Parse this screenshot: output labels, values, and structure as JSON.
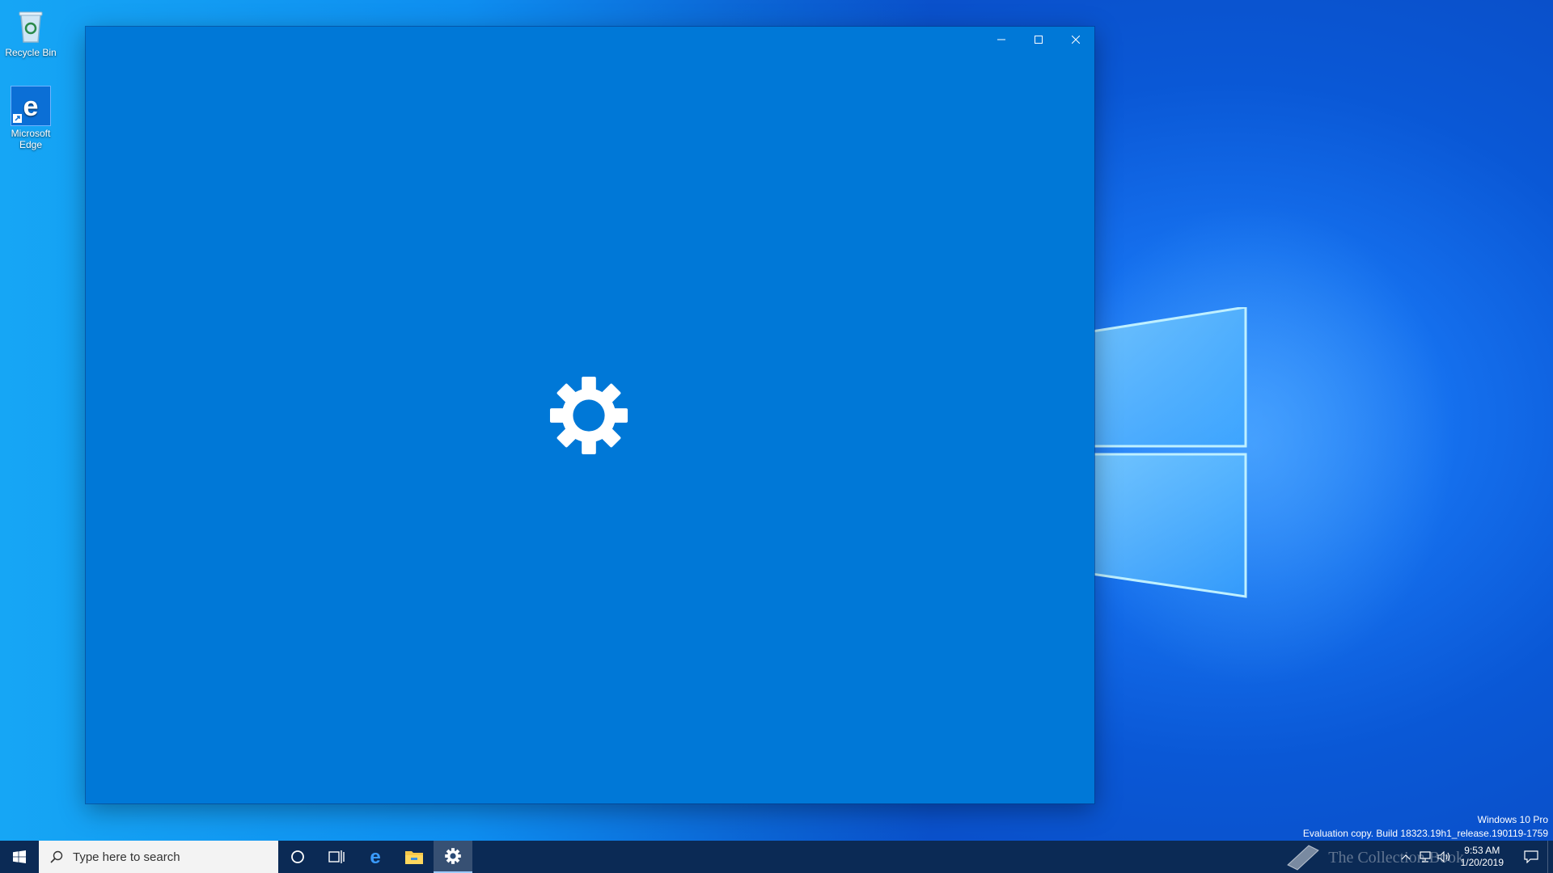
{
  "desktop": {
    "icons": [
      {
        "label": "Recycle Bin",
        "icon": "recycle-bin-icon"
      },
      {
        "label": "Microsoft Edge",
        "icon": "edge-icon"
      }
    ]
  },
  "window": {
    "splash_icon": "gear-icon",
    "accent_color": "#0078d7",
    "caption_buttons": [
      "minimize",
      "maximize",
      "close"
    ]
  },
  "watermark": {
    "line1": "Windows 10 Pro",
    "line2": "Evaluation copy. Build 18323.19h1_release.190119-1759"
  },
  "taskbar": {
    "search_placeholder": "Type here to search",
    "apps": [
      "cortana",
      "task-view",
      "edge",
      "file-explorer",
      "settings"
    ],
    "active_app": "settings",
    "clock_time": "9:53 AM",
    "clock_date": "1/20/2019"
  },
  "brand_overlay": "The Collection Book"
}
